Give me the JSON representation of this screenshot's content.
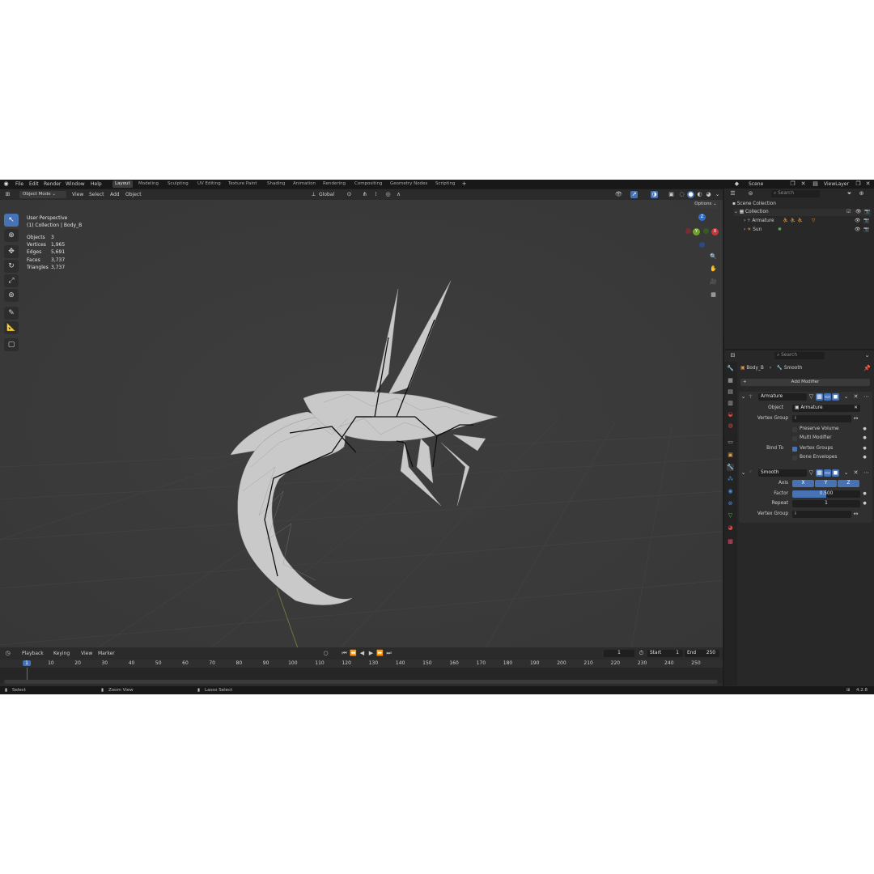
{
  "menu": [
    "File",
    "Edit",
    "Render",
    "Window",
    "Help"
  ],
  "workspaces": [
    "Layout",
    "Modeling",
    "Sculpting",
    "UV Editing",
    "Texture Paint",
    "Shading",
    "Animation",
    "Rendering",
    "Compositing",
    "Geometry Nodes",
    "Scripting"
  ],
  "active_workspace": "Layout",
  "scene_name": "Scene",
  "view_layer_name": "ViewLayer",
  "viewport_header": {
    "mode": "Object Mode",
    "menus": [
      "View",
      "Select",
      "Add",
      "Object"
    ],
    "transform_orientation": "Global",
    "options_label": "Options"
  },
  "viewport_info": {
    "perspective": "User Perspective",
    "context": "(1) Collection | Body_B"
  },
  "stats": [
    {
      "label": "Objects",
      "value": "3"
    },
    {
      "label": "Vertices",
      "value": "1,965"
    },
    {
      "label": "Edges",
      "value": "5,691"
    },
    {
      "label": "Faces",
      "value": "3,737"
    },
    {
      "label": "Triangles",
      "value": "3,737"
    }
  ],
  "gizmo_axes": {
    "z": "Z",
    "y": "Y",
    "x": "X"
  },
  "outliner": {
    "search_placeholder": "Search",
    "root": "Scene Collection",
    "collection": "Collection",
    "items": [
      "Armature",
      "Sun"
    ]
  },
  "properties": {
    "search_placeholder": "Search",
    "breadcrumb_object": "Body_B",
    "breadcrumb_modifier": "Smooth",
    "add_modifier": "Add Modifier",
    "armature_modifier": {
      "name": "Armature",
      "object_label": "Object",
      "object_value": "Armature",
      "vertex_group_label": "Vertex Group",
      "preserve_volume": "Preserve Volume",
      "multi_modifier": "Multi Modifier",
      "bind_to_label": "Bind To",
      "vertex_groups": "Vertex Groups",
      "bone_envelopes": "Bone Envelopes"
    },
    "smooth_modifier": {
      "name": "Smooth",
      "axis_label": "Axis",
      "axes": [
        "X",
        "Y",
        "Z"
      ],
      "factor_label": "Factor",
      "factor_value": "0.500",
      "repeat_label": "Repeat",
      "repeat_value": "1",
      "vertex_group_label": "Vertex Group"
    }
  },
  "timeline": {
    "menus": [
      "Playback",
      "Keying",
      "View",
      "Marker"
    ],
    "current_frame": "1",
    "start_label": "Start",
    "start_value": "1",
    "end_label": "End",
    "end_value": "250",
    "ticks": [
      "1",
      "10",
      "20",
      "30",
      "40",
      "50",
      "60",
      "70",
      "80",
      "90",
      "100",
      "110",
      "120",
      "130",
      "140",
      "150",
      "160",
      "170",
      "180",
      "190",
      "200",
      "210",
      "220",
      "230",
      "240",
      "250"
    ]
  },
  "status": {
    "select": "Select",
    "zoom": "Zoom View",
    "lasso": "Lasso Select",
    "version": "4.2.8"
  }
}
